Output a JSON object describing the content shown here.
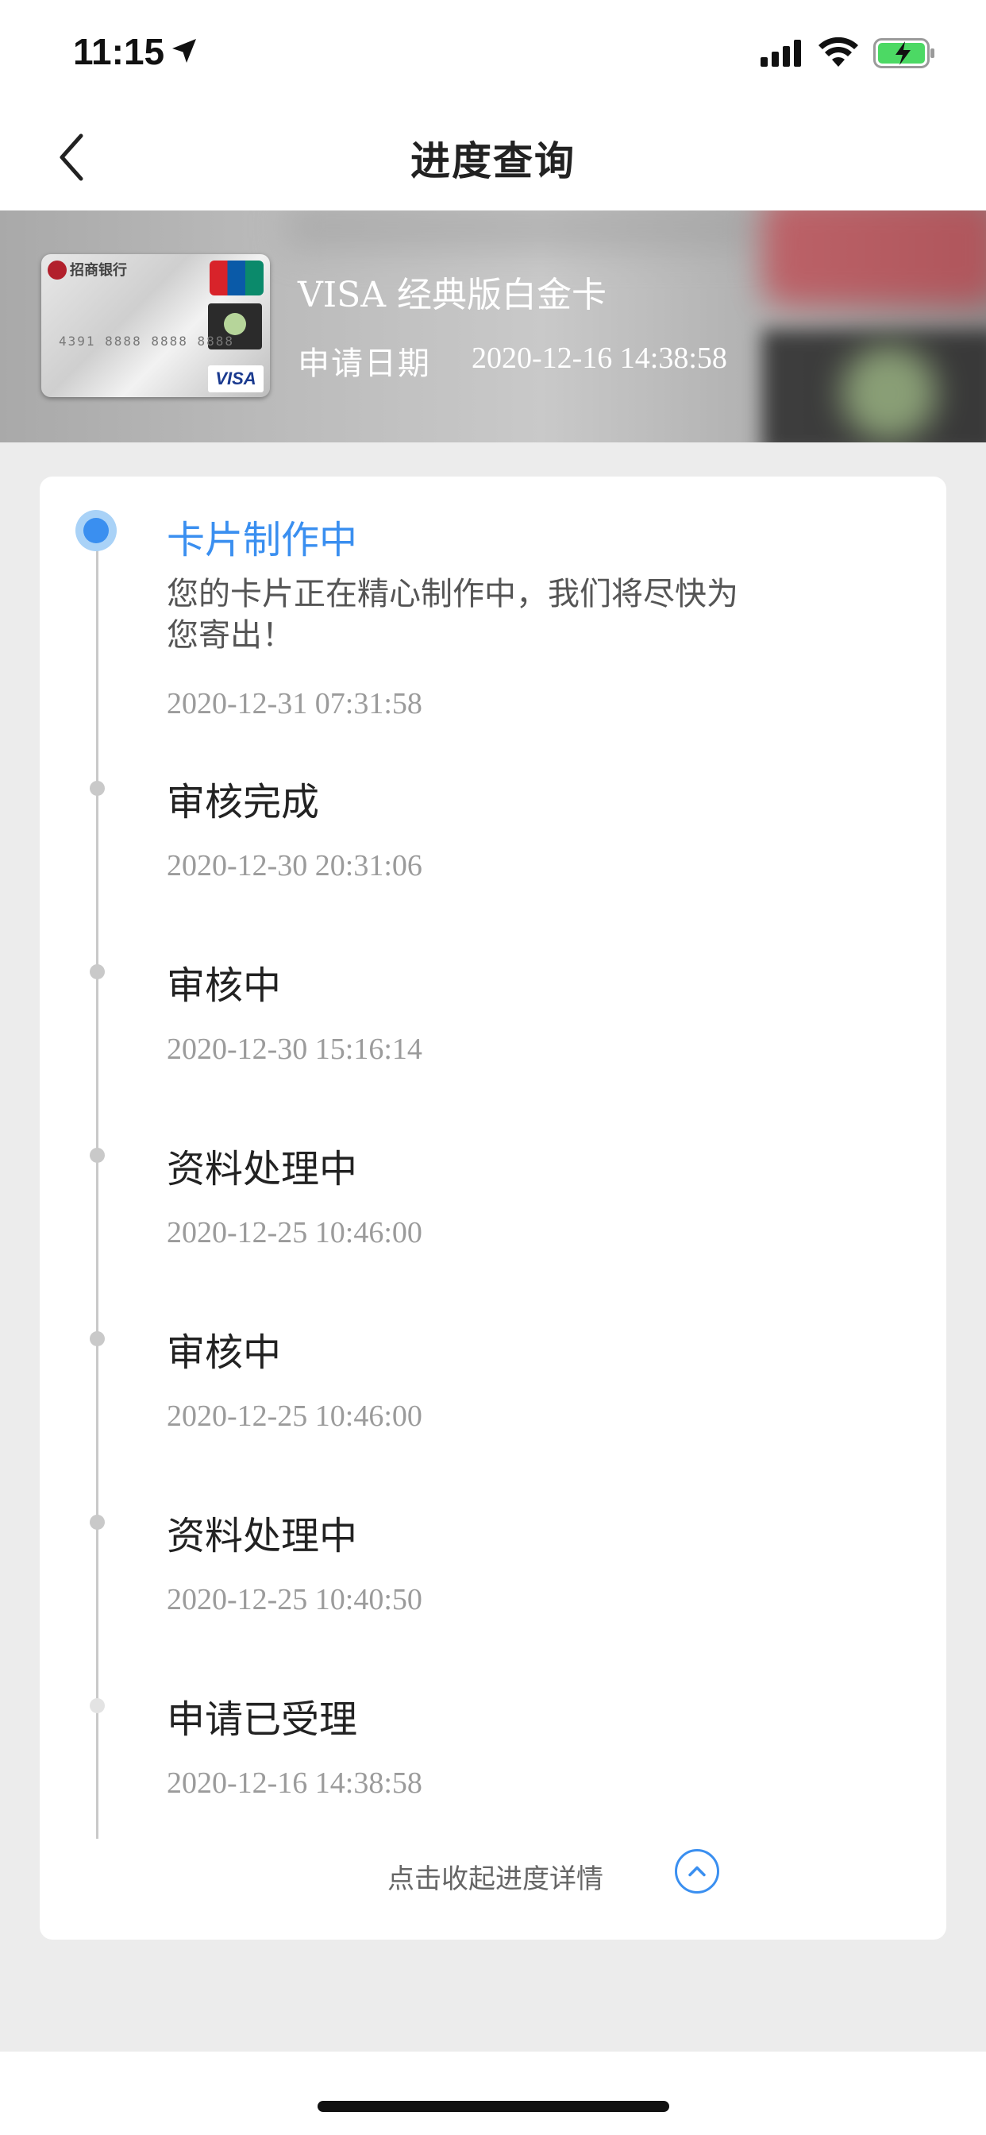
{
  "status_bar": {
    "time": "11:15"
  },
  "nav": {
    "title": "进度查询"
  },
  "card": {
    "name": "VISA 经典版白金卡",
    "apply_label": "申请日期",
    "apply_date": "2020-12-16 14:38:58"
  },
  "timeline": [
    {
      "title": "卡片制作中",
      "desc": "您的卡片正在精心制作中，我们将尽快为您寄出！",
      "time": "2020-12-31 07:31:58",
      "active": true
    },
    {
      "title": "审核完成",
      "time": "2020-12-30 20:31:06"
    },
    {
      "title": "审核中",
      "time": "2020-12-30 15:16:14"
    },
    {
      "title": "资料处理中",
      "time": "2020-12-25 10:46:00"
    },
    {
      "title": "审核中",
      "time": "2020-12-25 10:46:00"
    },
    {
      "title": "资料处理中",
      "time": "2020-12-25 10:40:50"
    },
    {
      "title": "申请已受理",
      "time": "2020-12-16 14:38:58"
    }
  ],
  "collapse": {
    "label": "点击收起进度详情"
  },
  "colors": {
    "accent": "#3a8ff0",
    "background": "#ececec"
  }
}
